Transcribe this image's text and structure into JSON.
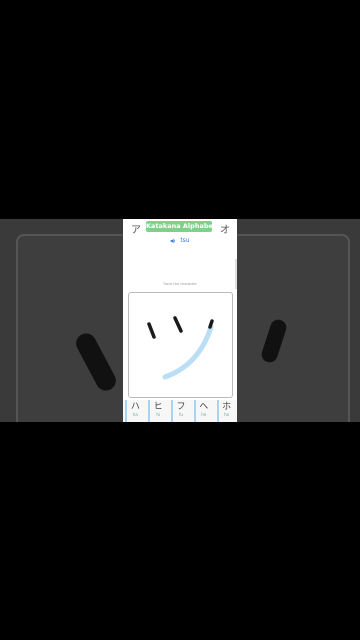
{
  "header": {
    "title": "Katakana Alphabet",
    "prev_kana": "ア",
    "next_kana": "オ"
  },
  "character": {
    "romaji": "tsu",
    "instruction": "Trace the character"
  },
  "kana_row": [
    {
      "kana": "ハ",
      "romaji": "ha"
    },
    {
      "kana": "ヒ",
      "romaji": "hi"
    },
    {
      "kana": "フ",
      "romaji": "fu"
    },
    {
      "kana": "ヘ",
      "romaji": "he"
    },
    {
      "kana": "ホ",
      "romaji": "ho"
    }
  ],
  "colors": {
    "title_bg": "#7fd18a",
    "accent": "#3a7bd5",
    "guide_stroke": "#b9def5"
  }
}
